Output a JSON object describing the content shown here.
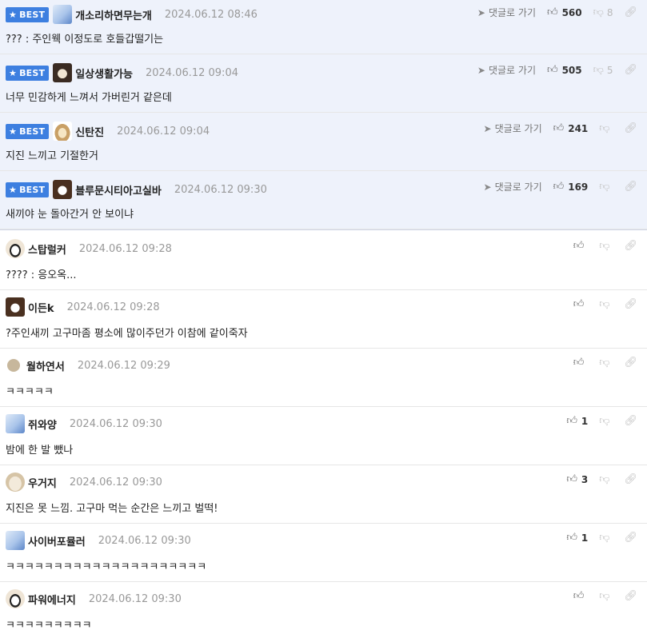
{
  "labels": {
    "best": "BEST",
    "reply_to": "댓글로 가기"
  },
  "best_comments": [
    {
      "nickname": "개소리하면무는개",
      "date": "2024.06.12 08:46",
      "text": "??? : 주인웩 이정도로 호들갑떨기는",
      "likes": "560",
      "dislikes": "8"
    },
    {
      "nickname": "일상생활가능",
      "date": "2024.06.12 09:04",
      "text": "너무 민감하게 느껴서 가버린거 같은데",
      "likes": "505",
      "dislikes": "5"
    },
    {
      "nickname": "신탄진",
      "date": "2024.06.12 09:04",
      "text": "지진 느끼고 기절한거",
      "likes": "241",
      "dislikes": ""
    },
    {
      "nickname": "블루문시티아고실바",
      "date": "2024.06.12 09:30",
      "text": "새끼야 눈 돌아간거 안 보이냐",
      "likes": "169",
      "dislikes": ""
    }
  ],
  "comments": [
    {
      "nickname": "스탑럴커",
      "date": "2024.06.12 09:28",
      "text": "???? : 응오옥...",
      "likes": ""
    },
    {
      "nickname": "이든k",
      "date": "2024.06.12 09:28",
      "text": "?주인새끼 고구마좀 평소에 많이주던가 이참에 같이죽자",
      "likes": ""
    },
    {
      "nickname": "월하연서",
      "date": "2024.06.12 09:29",
      "text": "ㅋㅋㅋㅋㅋ",
      "likes": ""
    },
    {
      "nickname": "쥐와양",
      "date": "2024.06.12 09:30",
      "text": "밤에 한 발 뺐나",
      "likes": "1"
    },
    {
      "nickname": "우거지",
      "date": "2024.06.12 09:30",
      "text": "지진은 못 느낌. 고구마 먹는 순간은 느끼고 벌떡!",
      "likes": "3"
    },
    {
      "nickname": "사이버포뮬러",
      "date": "2024.06.12 09:30",
      "text": "ㅋㅋㅋㅋㅋㅋㅋㅋㅋㅋㅋㅋㅋㅋㅋㅋㅋㅋㅋㅋㅋ",
      "likes": "1"
    },
    {
      "nickname": "파워에너지",
      "date": "2024.06.12 09:30",
      "text": "ㅋㅋㅋㅋㅋㅋㅋㅋㅋ",
      "likes": ""
    }
  ],
  "icons": {
    "best_star": "star-icon",
    "reply_arrow": "arrow-icon",
    "like": "thumbs-up-icon",
    "dislike": "thumbs-down-icon",
    "link": "link-icon"
  },
  "colors": {
    "best_badge": "#3d7fe0",
    "best_bg": "#eef2fb"
  }
}
